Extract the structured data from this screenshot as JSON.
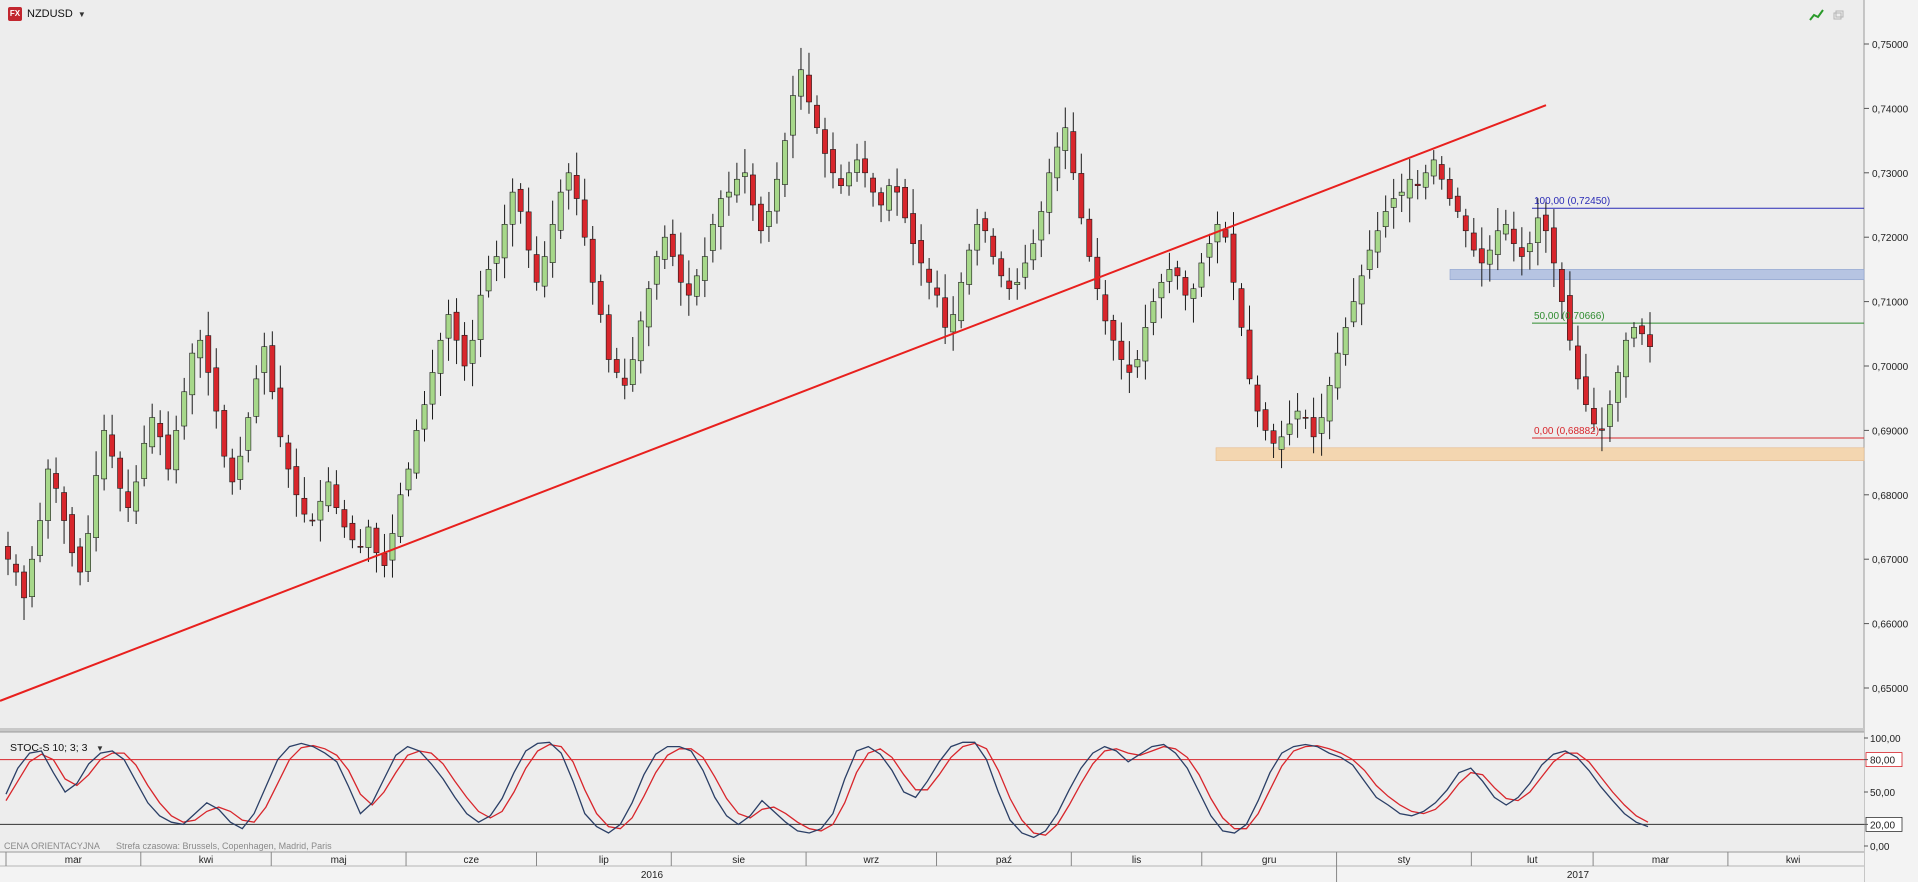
{
  "header": {
    "symbol": "NZDUSD",
    "logo_text": "FX",
    "dropdown_icon": "chevron-down-icon",
    "right_icons": [
      "trend-line-icon",
      "window-restore-icon"
    ]
  },
  "indicator": {
    "label": "STOC-S 10; 3; 3",
    "levels": [
      "100,00",
      "80,00",
      "50,00",
      "20,00",
      "0,00"
    ]
  },
  "footer": {
    "price_note": "CENA ORIENTACYJNA",
    "timezone_note": "Strefa czasowa: Brussels, Copenhagen, Madrid, Paris",
    "months": [
      "mar",
      "kwi",
      "maj",
      "cze",
      "lip",
      "sie",
      "wrz",
      "paź",
      "lis",
      "gru",
      "sty",
      "lut",
      "mar",
      "kwi"
    ],
    "years": [
      "2016",
      "2017"
    ]
  },
  "colors": {
    "bull": "#a7d88a",
    "bear": "#d8262c",
    "trendline": "#e8201e",
    "fib100": "#2a2bb6",
    "fib50": "#2e8b2e",
    "fib0": "#d8262c",
    "zone_blue": "#b6c4e2",
    "zone_orange": "#f3d6b0",
    "stoch_k": "#2b3f66",
    "stoch_d": "#d8262c"
  },
  "chart_data": {
    "type": "candlestick",
    "symbol": "NZDUSD",
    "yaxis_ticks": [
      "0,75000",
      "0,74000",
      "0,73000",
      "0,72000",
      "0,71000",
      "0,70000",
      "0,69000",
      "0,68000",
      "0,67000",
      "0,66000",
      "0,65000"
    ],
    "ylim": [
      0.6455,
      0.7515
    ],
    "annotations": [
      {
        "label": "100,00 (0,72450)",
        "value": 0.7245
      },
      {
        "label": "50,00 (0,70666)",
        "value": 0.70666
      },
      {
        "label": "0,00 (0,68882)",
        "value": 0.68882
      }
    ],
    "zones": [
      {
        "from": 0.7134,
        "to": 0.715
      },
      {
        "from": 0.6853,
        "to": 0.6873
      }
    ],
    "trendline": {
      "start": [
        "2016-03-01",
        0.648
      ],
      "end": [
        "2017-02-10",
        0.7405
      ]
    },
    "date_range": [
      "2016-03-01",
      "2017-04-30"
    ],
    "close": [
      0.67,
      0.668,
      0.664,
      0.67,
      0.676,
      0.684,
      0.681,
      0.676,
      0.671,
      0.668,
      0.674,
      0.683,
      0.69,
      0.686,
      0.681,
      0.678,
      0.682,
      0.688,
      0.692,
      0.689,
      0.684,
      0.69,
      0.696,
      0.702,
      0.704,
      0.699,
      0.693,
      0.686,
      0.682,
      0.686,
      0.692,
      0.698,
      0.703,
      0.696,
      0.689,
      0.684,
      0.68,
      0.677,
      0.676,
      0.679,
      0.682,
      0.678,
      0.675,
      0.673,
      0.672,
      0.675,
      0.671,
      0.669,
      0.674,
      0.68,
      0.684,
      0.69,
      0.694,
      0.699,
      0.704,
      0.708,
      0.704,
      0.7,
      0.704,
      0.711,
      0.715,
      0.717,
      0.722,
      0.727,
      0.724,
      0.718,
      0.713,
      0.717,
      0.722,
      0.727,
      0.73,
      0.726,
      0.72,
      0.713,
      0.708,
      0.701,
      0.699,
      0.697,
      0.701,
      0.707,
      0.712,
      0.717,
      0.72,
      0.717,
      0.713,
      0.711,
      0.714,
      0.717,
      0.722,
      0.726,
      0.727,
      0.729,
      0.73,
      0.725,
      0.721,
      0.724,
      0.729,
      0.735,
      0.742,
      0.746,
      0.741,
      0.737,
      0.733,
      0.73,
      0.728,
      0.73,
      0.732,
      0.73,
      0.727,
      0.725,
      0.728,
      0.727,
      0.723,
      0.719,
      0.716,
      0.713,
      0.711,
      0.706,
      0.708,
      0.713,
      0.718,
      0.722,
      0.721,
      0.717,
      0.714,
      0.712,
      0.713,
      0.716,
      0.719,
      0.724,
      0.73,
      0.734,
      0.737,
      0.73,
      0.723,
      0.717,
      0.712,
      0.707,
      0.704,
      0.701,
      0.699,
      0.701,
      0.706,
      0.71,
      0.713,
      0.715,
      0.714,
      0.711,
      0.712,
      0.716,
      0.719,
      0.722,
      0.72,
      0.713,
      0.706,
      0.698,
      0.693,
      0.69,
      0.688,
      0.689,
      0.691,
      0.693,
      0.692,
      0.689,
      0.692,
      0.697,
      0.702,
      0.706,
      0.71,
      0.714,
      0.718,
      0.721,
      0.724,
      0.726,
      0.727,
      0.729,
      0.728,
      0.73,
      0.732,
      0.729,
      0.726,
      0.724,
      0.721,
      0.718,
      0.716,
      0.718,
      0.721,
      0.722,
      0.719,
      0.717,
      0.719,
      0.723,
      0.721,
      0.716,
      0.71,
      0.704,
      0.698,
      0.694,
      0.691,
      0.69,
      0.694,
      0.699,
      0.704,
      0.706,
      0.705,
      0.703
    ],
    "stochastic": {
      "label": "STOC-S 10; 3; 3",
      "ylim": [
        0,
        100
      ],
      "levels": [
        20,
        80
      ],
      "k": [
        48,
        72,
        86,
        88,
        68,
        50,
        58,
        76,
        86,
        88,
        80,
        60,
        40,
        28,
        22,
        20,
        30,
        40,
        34,
        22,
        16,
        30,
        55,
        80,
        92,
        95,
        92,
        86,
        78,
        55,
        30,
        40,
        62,
        84,
        92,
        88,
        76,
        62,
        45,
        30,
        22,
        28,
        44,
        68,
        88,
        95,
        96,
        86,
        60,
        30,
        18,
        12,
        20,
        40,
        66,
        85,
        92,
        92,
        88,
        70,
        45,
        28,
        20,
        28,
        42,
        32,
        22,
        14,
        12,
        16,
        30,
        62,
        88,
        92,
        85,
        70,
        50,
        45,
        60,
        78,
        92,
        96,
        96,
        80,
        50,
        24,
        12,
        8,
        14,
        30,
        52,
        72,
        86,
        92,
        88,
        78,
        85,
        92,
        94,
        86,
        72,
        50,
        28,
        14,
        12,
        20,
        42,
        68,
        86,
        92,
        94,
        92,
        86,
        82,
        75,
        60,
        45,
        38,
        30,
        28,
        32,
        40,
        52,
        68,
        72,
        60,
        45,
        38,
        45,
        58,
        75,
        85,
        88,
        82,
        70,
        55,
        42,
        30,
        22,
        18
      ],
      "d": [
        42,
        60,
        78,
        85,
        80,
        62,
        56,
        66,
        80,
        86,
        86,
        75,
        56,
        40,
        28,
        22,
        24,
        32,
        36,
        32,
        24,
        22,
        36,
        58,
        80,
        91,
        93,
        90,
        84,
        70,
        48,
        38,
        50,
        68,
        84,
        88,
        86,
        76,
        60,
        45,
        32,
        26,
        32,
        50,
        72,
        88,
        94,
        92,
        78,
        52,
        30,
        18,
        16,
        26,
        46,
        68,
        84,
        90,
        90,
        82,
        64,
        44,
        30,
        26,
        34,
        36,
        30,
        22,
        16,
        14,
        20,
        40,
        68,
        86,
        90,
        82,
        66,
        52,
        52,
        66,
        82,
        92,
        95,
        90,
        70,
        44,
        24,
        12,
        10,
        20,
        38,
        58,
        76,
        88,
        90,
        86,
        84,
        88,
        92,
        90,
        82,
        66,
        44,
        26,
        16,
        16,
        30,
        52,
        74,
        88,
        92,
        93,
        90,
        86,
        80,
        70,
        56,
        46,
        38,
        32,
        30,
        34,
        44,
        58,
        68,
        66,
        54,
        44,
        42,
        50,
        64,
        78,
        86,
        86,
        78,
        64,
        50,
        38,
        28,
        22
      ]
    }
  }
}
